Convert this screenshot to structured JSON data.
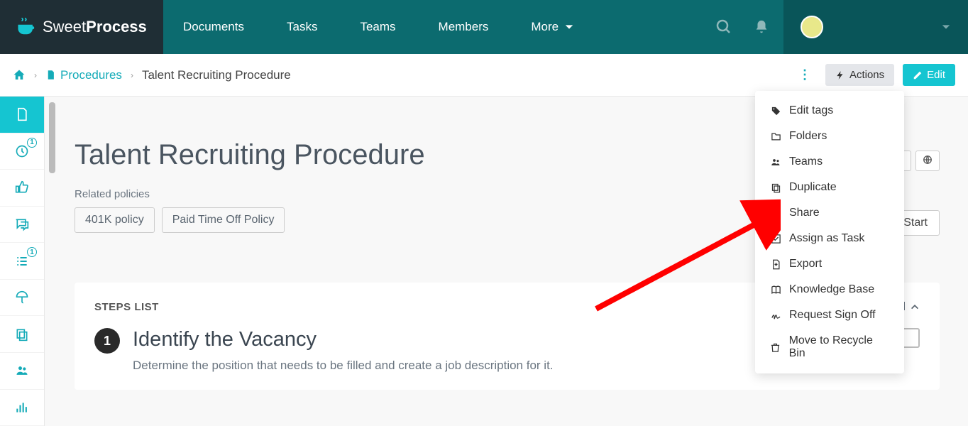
{
  "brand": {
    "part1": "Sweet",
    "part2": "Process"
  },
  "nav": {
    "documents": "Documents",
    "tasks": "Tasks",
    "teams": "Teams",
    "members": "Members",
    "more": "More"
  },
  "breadcrumb": {
    "procedures": "Procedures",
    "current": "Talent Recruiting Procedure"
  },
  "buttons": {
    "actions": "Actions",
    "edit": "Edit",
    "start": "Start"
  },
  "sidebar": {
    "badge_history": "1",
    "badge_tasks": "1"
  },
  "page": {
    "title": "Talent Recruiting Procedure",
    "related_label": "Related policies",
    "policies": {
      "p1": "401K policy",
      "p2": "Paid Time Off Policy"
    }
  },
  "steps": {
    "header": "STEPS LIST",
    "collapse": "Collapse All",
    "s1": {
      "num": "1",
      "name": "Identify the Vacancy",
      "desc": "Determine the position that needs to be filled and create a job description for it."
    }
  },
  "dropdown": {
    "edit_tags": "Edit tags",
    "folders": "Folders",
    "teams": "Teams",
    "duplicate": "Duplicate",
    "share": "Share",
    "assign_task": "Assign as Task",
    "export": "Export",
    "knowledge_base": "Knowledge Base",
    "request_signoff": "Request Sign Off",
    "recycle_bin": "Move to Recycle Bin"
  }
}
